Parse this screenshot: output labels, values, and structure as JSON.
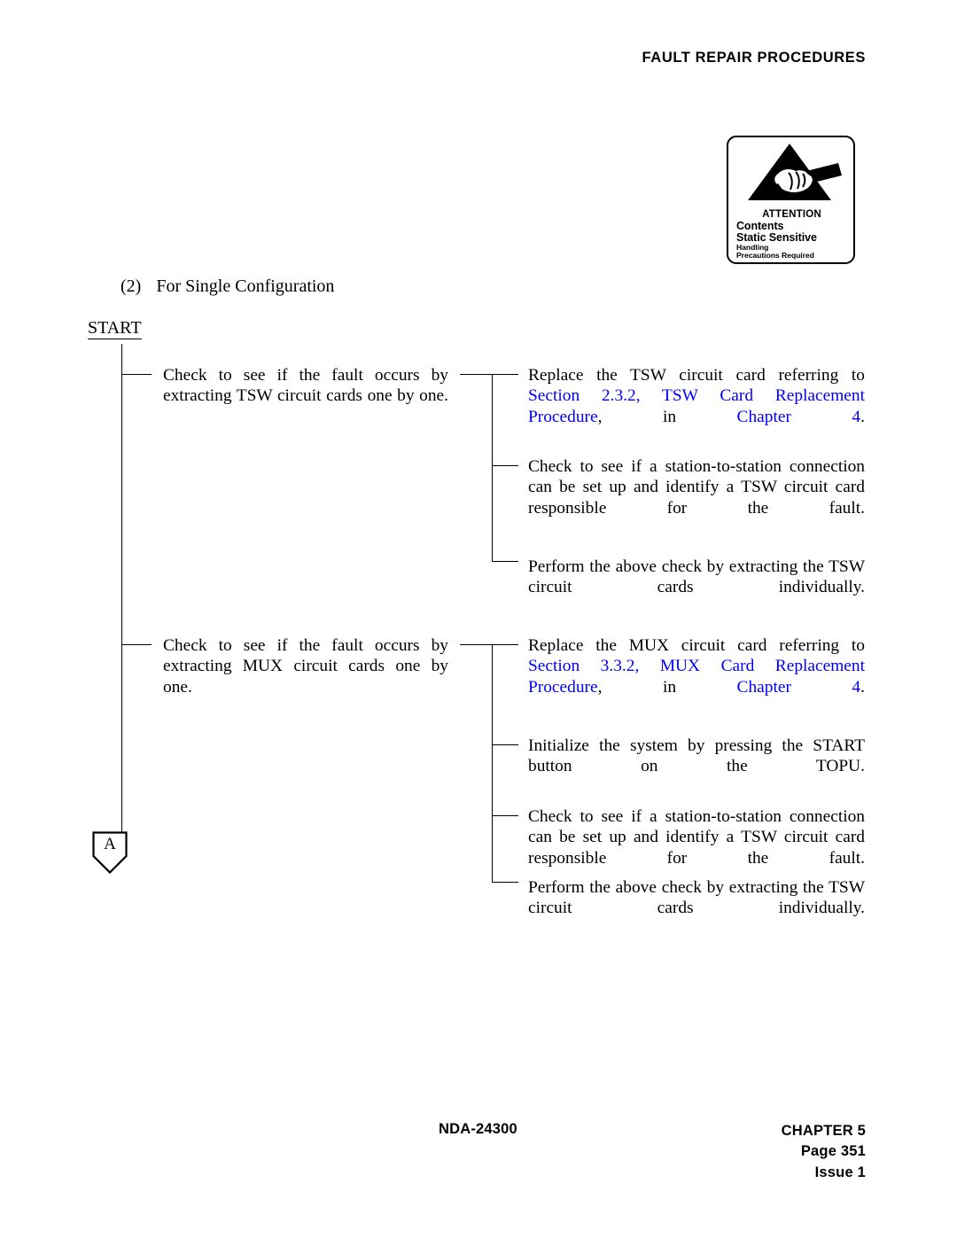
{
  "header": {
    "title": "FAULT REPAIR PROCEDURES"
  },
  "esd_label": {
    "icon": "esd-static-sensitive-icon",
    "attention": "ATTENTION",
    "line1": "Contents",
    "line2": "Static Sensitive",
    "line3": "Handling",
    "line4": "Precautions Required"
  },
  "section": {
    "number": "(2)",
    "title": "For Single Configuration"
  },
  "flowchart": {
    "start_label": "START",
    "connector_label": "A",
    "groups": [
      {
        "condition": "Check to see if the fault occurs by extracting TSW circuit cards one by one.",
        "actions": [
          {
            "prefix": "Replace the TSW circuit card referring to ",
            "link1": "Section 2.3.2, TSW Card Replacement Procedure",
            "mid": ", in ",
            "link2": "Chapter 4",
            "suffix": "."
          },
          {
            "text": "Check to see if a station-to-station connection can be set up and identify a TSW circuit card responsible for the fault."
          },
          {
            "text": "Perform the above check by extracting the TSW circuit cards individually."
          }
        ]
      },
      {
        "condition": "Check to see if the fault occurs by extracting MUX circuit cards one by one.",
        "actions": [
          {
            "prefix": "Replace the MUX circuit card referring to ",
            "link1": "Section 3.3.2, MUX Card Replacement Procedure",
            "mid": ", in ",
            "link2": "Chapter 4",
            "suffix": "."
          },
          {
            "text": "Initialize the system by pressing the START button on the TOPU."
          },
          {
            "text": "Check to see if a station-to-station connection can be set up and identify a TSW circuit card responsible for the fault."
          },
          {
            "text": "Perform the above check by extracting the TSW circuit cards individually."
          }
        ]
      }
    ]
  },
  "footer": {
    "doc_number": "NDA-24300",
    "chapter": "CHAPTER 5",
    "page": "Page 351",
    "issue": "Issue 1"
  },
  "colors": {
    "link": "#0000ff",
    "text": "#000000"
  }
}
